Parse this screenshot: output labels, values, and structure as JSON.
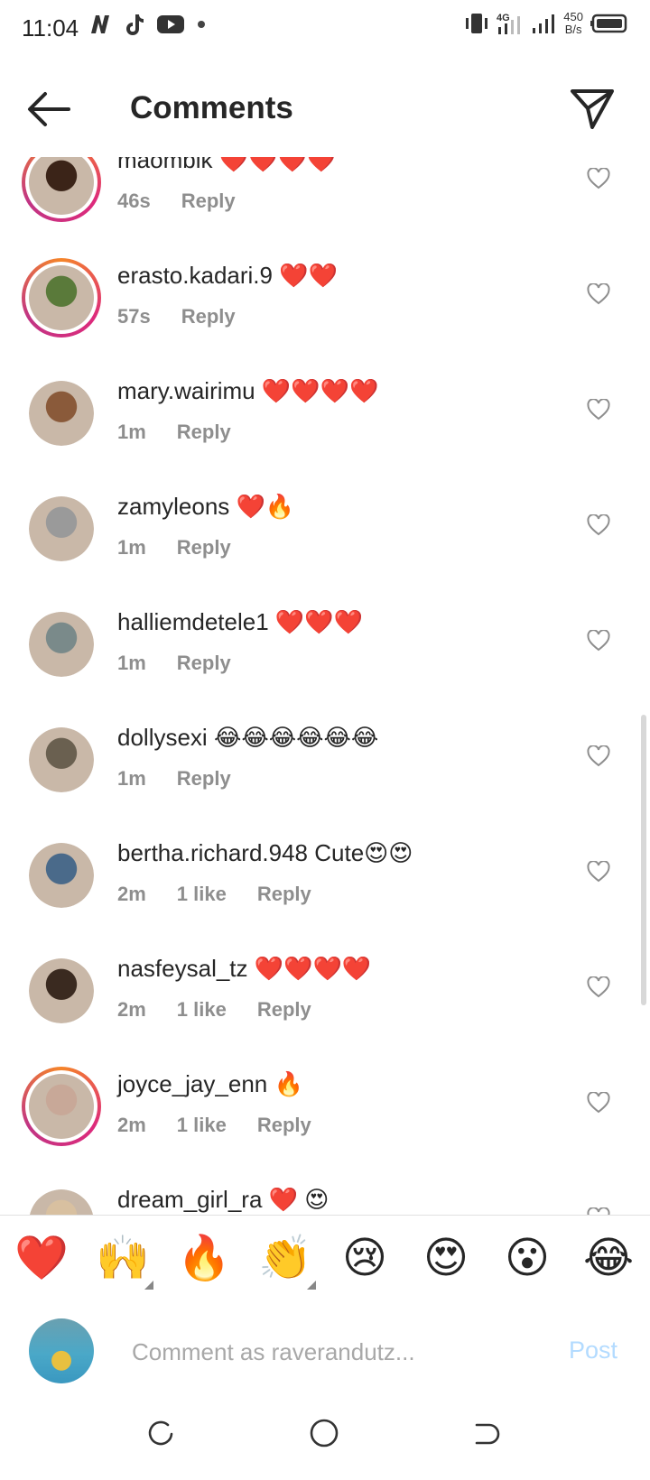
{
  "status_bar": {
    "time": "11:04",
    "network": "4G",
    "speed_value": "450",
    "speed_unit": "B/s"
  },
  "header": {
    "title": "Comments"
  },
  "comments": [
    {
      "username": "maombik",
      "text": "❤️❤️❤️❤️",
      "time": "46s",
      "likes": "",
      "reply": "Reply",
      "ring": true,
      "avatar": "#3b2418"
    },
    {
      "username": "erasto.kadari.9",
      "text": "❤️❤️",
      "time": "57s",
      "likes": "",
      "reply": "Reply",
      "ring": true,
      "avatar": "#5a7a3a"
    },
    {
      "username": "mary.wairimu",
      "text": "❤️❤️❤️❤️",
      "time": "1m",
      "likes": "",
      "reply": "Reply",
      "ring": false,
      "avatar": "#8a5a3a"
    },
    {
      "username": "zamyleons",
      "text": "❤️🔥",
      "time": "1m",
      "likes": "",
      "reply": "Reply",
      "ring": false,
      "avatar": "#9a9a9a"
    },
    {
      "username": "halliemdetele1",
      "text": "❤️❤️❤️",
      "time": "1m",
      "likes": "",
      "reply": "Reply",
      "ring": false,
      "avatar": "#7a8a8a"
    },
    {
      "username": "dollysexi",
      "text": "😂😂😂😂😂😂",
      "time": "1m",
      "likes": "",
      "reply": "Reply",
      "ring": false,
      "avatar": "#6a6050"
    },
    {
      "username": "bertha.richard.948",
      "text": "Cute😍😍",
      "time": "2m",
      "likes": "1 like",
      "reply": "Reply",
      "ring": false,
      "avatar": "#4a6a8a"
    },
    {
      "username": "nasfeysal_tz",
      "text": "❤️❤️❤️❤️",
      "time": "2m",
      "likes": "1 like",
      "reply": "Reply",
      "ring": false,
      "avatar": "#3a2a20"
    },
    {
      "username": "joyce_jay_enn",
      "text": "🔥",
      "time": "2m",
      "likes": "1 like",
      "reply": "Reply",
      "ring": true,
      "avatar": "#c8a898"
    },
    {
      "username": "dream_girl_ra",
      "text": "❤️ 😍",
      "time": "",
      "likes": "",
      "reply": "",
      "ring": false,
      "avatar": "#d8c0a0"
    }
  ],
  "quick_reactions": [
    "❤️",
    "🙌",
    "🔥",
    "👏",
    "😢",
    "😍",
    "😮",
    "😂"
  ],
  "compose": {
    "placeholder": "Comment as raverandutz...",
    "post_label": "Post"
  }
}
